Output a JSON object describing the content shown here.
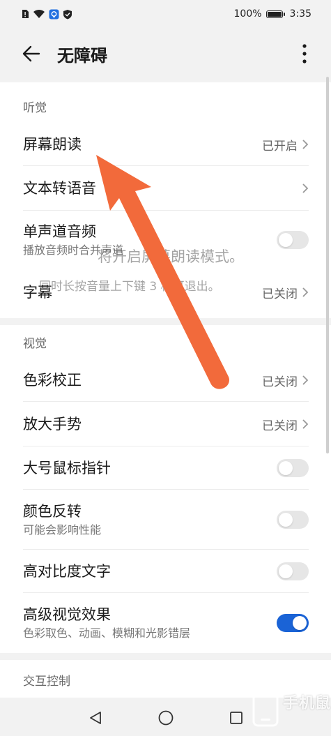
{
  "status_bar": {
    "battery_text": "100%",
    "time": "3:35",
    "icons": [
      "sim-alert-icon",
      "wifi-icon",
      "app-notification-icon",
      "shield-icon"
    ]
  },
  "app_bar": {
    "title": "无障碍",
    "back_icon": "arrow-left-icon",
    "more_icon": "more-vertical-icon"
  },
  "sections": {
    "hearing": {
      "header": "听觉",
      "items": [
        {
          "label": "屏幕朗读",
          "value": "已开启",
          "control": "chevron"
        },
        {
          "label": "文本转语音",
          "value": "",
          "control": "chevron"
        },
        {
          "label": "单声道音频",
          "sub": "播放音频时合并声道",
          "control": "toggle",
          "on": false
        },
        {
          "label": "字幕",
          "value": "已关闭",
          "control": "chevron"
        }
      ]
    },
    "vision": {
      "header": "视觉",
      "items": [
        {
          "label": "色彩校正",
          "value": "已关闭",
          "control": "chevron"
        },
        {
          "label": "放大手势",
          "value": "已关闭",
          "control": "chevron"
        },
        {
          "label": "大号鼠标指针",
          "control": "toggle",
          "on": false
        },
        {
          "label": "颜色反转",
          "sub": "可能会影响性能",
          "control": "toggle",
          "on": false
        },
        {
          "label": "高对比度文字",
          "control": "toggle",
          "on": false
        },
        {
          "label": "高级视觉效果",
          "sub": "色彩取色、动画、模糊和光影错层",
          "control": "toggle",
          "on": true
        }
      ]
    },
    "interaction": {
      "header": "交互控制"
    }
  },
  "overlay_toast": {
    "line1": "将开启屏幕朗读模式。",
    "line2": "同时长按音量上下键 3 秒可退出。"
  },
  "nav_bar": {
    "back_icon": "triangle-back-icon",
    "home_icon": "circle-home-icon",
    "recent_icon": "square-recent-icon"
  },
  "watermark": {
    "text": "手机鼠"
  },
  "colors": {
    "accent": "#1a63d6",
    "annotation_arrow": "#f26a3b",
    "background": "#f2f2f2",
    "card": "#ffffff"
  }
}
